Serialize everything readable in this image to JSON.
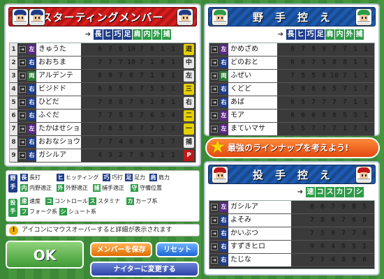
{
  "starting": {
    "title": "スターティングメンバー",
    "headers": [
      "長",
      "ヒ",
      "巧",
      "足",
      "肩",
      "内",
      "外",
      "捕"
    ],
    "rows": [
      {
        "no": "1",
        "hand": "左",
        "name": "きゅうた",
        "stats": [
          "6",
          "7",
          "6",
          "10",
          "7",
          "8",
          "1",
          "1"
        ],
        "pos": "遊",
        "pos_color": "y"
      },
      {
        "no": "2",
        "hand": "右",
        "name": "おおちま",
        "stats": [
          "7",
          "7",
          "7",
          "10",
          "7",
          "1",
          "8",
          "1"
        ],
        "pos": "中",
        "pos_color": "w"
      },
      {
        "no": "3",
        "hand": "両",
        "name": "アルデンテ",
        "stats": [
          "8",
          "9",
          "7",
          "6",
          "7",
          "1",
          "8",
          "1"
        ],
        "pos": "左",
        "pos_color": "w"
      },
      {
        "no": "4",
        "hand": "右",
        "name": "ビジドド",
        "stats": [
          "8",
          "8",
          "5",
          "6",
          "7",
          "5",
          "5",
          "1"
        ],
        "pos": "三",
        "pos_color": "y"
      },
      {
        "no": "5",
        "hand": "右",
        "name": "ひどだ",
        "stats": [
          "7",
          "8",
          "8",
          "7",
          "9",
          "1",
          "8",
          "1"
        ],
        "pos": "右",
        "pos_color": "w"
      },
      {
        "no": "6",
        "hand": "右",
        "name": "ふぐだ",
        "stats": [
          "7",
          "7",
          "5",
          "5",
          "7",
          "6",
          "5",
          "4"
        ],
        "pos": "二",
        "pos_color": "y"
      },
      {
        "no": "7",
        "hand": "左",
        "name": "たかはせショウ",
        "stats": [
          "7",
          "6",
          "5",
          "6",
          "7",
          "7",
          "1",
          "1"
        ],
        "pos": "一",
        "pos_color": "y"
      },
      {
        "no": "8",
        "hand": "右",
        "name": "おおなショウ",
        "stats": [
          "7",
          "7",
          "4",
          "6",
          "6",
          "1",
          "1",
          "7"
        ],
        "pos": "捕",
        "pos_color": "w"
      },
      {
        "no": "9",
        "hand": "右",
        "name": "ガシルア",
        "stats": [
          "4",
          "3",
          "2",
          "7",
          "6",
          "3",
          "1",
          "1"
        ],
        "pos": "P",
        "pos_color": "r"
      }
    ]
  },
  "bench_fielders": {
    "title": "野　手　控　え",
    "headers": [
      "長",
      "ヒ",
      "巧",
      "足",
      "肩",
      "内",
      "外",
      "捕"
    ],
    "rows": [
      {
        "hand": "左",
        "name": "かめざめ",
        "stats": [
          "6",
          "7",
          "8",
          "9",
          "7",
          "7",
          "1",
          "1"
        ]
      },
      {
        "hand": "右",
        "name": "どのおと",
        "stats": [
          "6",
          "6",
          "7",
          "5",
          "8",
          "8",
          "1",
          "1"
        ]
      },
      {
        "hand": "両",
        "name": "ふぜい",
        "stats": [
          "7",
          "5",
          "5",
          "8",
          "10",
          "7",
          "1",
          "1"
        ]
      },
      {
        "hand": "右",
        "name": "くどど",
        "stats": [
          "5",
          "8",
          "8",
          "6",
          "5",
          "7",
          "1",
          "7"
        ]
      },
      {
        "hand": "右",
        "name": "あば",
        "stats": [
          "6",
          "5",
          "7",
          "7",
          "7",
          "7",
          "1",
          "1"
        ]
      },
      {
        "hand": "左",
        "name": "モア",
        "stats": [
          "6",
          "6",
          "6",
          "8",
          "8",
          "5",
          "5",
          "1"
        ]
      },
      {
        "hand": "左",
        "name": "まていマサ",
        "stats": [
          "5",
          "5",
          "7",
          "7",
          "7",
          "1",
          "7",
          "1"
        ]
      }
    ]
  },
  "strategy_banner": "最強のラインナップを考えよう!",
  "bench_pitchers": {
    "title": "投　手　控　え",
    "headers": [
      "速",
      "コ",
      "ス",
      "カ",
      "フ",
      "シ"
    ],
    "rows": [
      {
        "hand": "左",
        "name": "ガシルア",
        "stats": [
          "8",
          "6",
          "7",
          "9",
          "8",
          "5"
        ]
      },
      {
        "hand": "右",
        "name": "よそみ",
        "stats": [
          "7",
          "8",
          "6",
          "7",
          "6",
          "8"
        ]
      },
      {
        "hand": "右",
        "name": "かいぶつ",
        "stats": [
          "7",
          "5",
          "9",
          "7",
          "7",
          "6"
        ]
      },
      {
        "hand": "右",
        "name": "すずきヒロ",
        "stats": [
          "9",
          "6",
          "4",
          "8",
          "5",
          "1"
        ]
      },
      {
        "hand": "右",
        "name": "たじな",
        "stats": [
          "7",
          "7",
          "4",
          "8",
          "9",
          "6"
        ]
      }
    ]
  },
  "legend": {
    "fielder_side": "野手",
    "pitcher_side": "投手",
    "items": [
      {
        "k": "長",
        "t": "長打"
      },
      {
        "k": "ヒ",
        "t": "ヒッティング"
      },
      {
        "k": "巧",
        "t": "巧打"
      },
      {
        "k": "足",
        "t": "足力"
      },
      {
        "k": "肩",
        "t": "肩力"
      },
      {
        "k": "内",
        "t": "内野適正"
      },
      {
        "k": "外",
        "t": "外野適正"
      },
      {
        "k": "捕",
        "t": "捕手適正"
      },
      {
        "k": "守",
        "t": "守備位置"
      },
      {
        "k": "速",
        "t": "速度"
      },
      {
        "k": "コ",
        "t": "コントロール"
      },
      {
        "k": "ス",
        "t": "スタミナ"
      },
      {
        "k": "カ",
        "t": "カーブ系"
      },
      {
        "k": "フ",
        "t": "フォーク系"
      },
      {
        "k": "シ",
        "t": "シュート系"
      }
    ]
  },
  "tip": {
    "icon": "!",
    "text": "アイコンにマウスオーバーすると詳細が表示されます"
  },
  "buttons": {
    "ok": "OK",
    "save": "メンバーを保存",
    "reset": "リセット",
    "night": "ナイターに変更する"
  },
  "colors": {
    "panel_red": "#d71e1e",
    "panel_blue": "#1e5bb0",
    "header_blue": "#1f3d8a",
    "header_green": "#2d9b48"
  }
}
